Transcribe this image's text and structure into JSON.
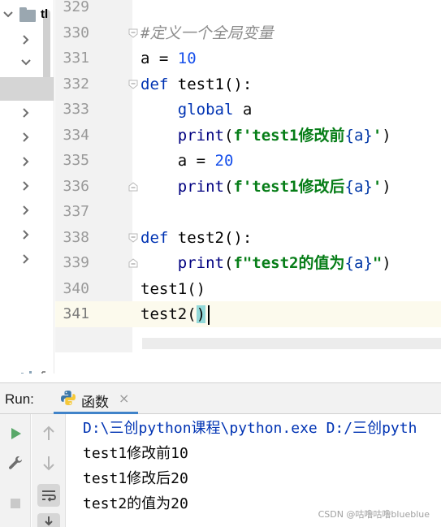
{
  "project_tree": {
    "root_label": "tl",
    "rows": [
      {
        "icon": "chevron-down-icon"
      },
      {
        "icon": "chevron-right-icon"
      },
      {
        "icon": "chevron-down-icon"
      },
      {
        "icon": "none"
      },
      {
        "icon": "chevron-right-icon"
      },
      {
        "icon": "chevron-right-icon"
      },
      {
        "icon": "chevron-right-icon"
      },
      {
        "icon": "chevron-right-icon"
      },
      {
        "icon": "chevron-right-icon"
      },
      {
        "icon": "chevron-right-icon"
      },
      {
        "icon": "chevron-right-icon"
      }
    ]
  },
  "editor": {
    "lines": [
      {
        "num": "329",
        "text": ""
      },
      {
        "num": "330",
        "text": "#定义一个全局变量"
      },
      {
        "num": "331",
        "text": "a = 10"
      },
      {
        "num": "332",
        "text": "def test1():"
      },
      {
        "num": "333",
        "text": "    global a"
      },
      {
        "num": "334",
        "text": "    print(f'test1修改前{a}')"
      },
      {
        "num": "335",
        "text": "    a = 20"
      },
      {
        "num": "336",
        "text": "    print(f'test1修改后{a}')"
      },
      {
        "num": "337",
        "text": ""
      },
      {
        "num": "338",
        "text": "def test2():"
      },
      {
        "num": "339",
        "text": "    print(f\"test2的值为{a}\")"
      },
      {
        "num": "340",
        "text": "test1()"
      },
      {
        "num": "341",
        "text": "test2()"
      }
    ],
    "current_line": "341",
    "colors": {
      "keyword": "#0033b3",
      "number": "#1750eb",
      "string": "#067d17",
      "comment": "#8c8c8c",
      "current_line_bg": "#fcfaed",
      "paren_match": "#93d9d9"
    }
  },
  "run_panel": {
    "title": "Run:",
    "tab_label": "函数",
    "tab_close": "×",
    "left_toolbar": [
      "run-icon",
      "wrench-icon",
      "stop-icon"
    ],
    "right_toolbar": [
      "arrow-up-icon",
      "arrow-down-icon",
      "soft-wrap-icon",
      "scroll-to-end-icon"
    ],
    "console": [
      "D:\\三创python课程\\python.exe D:/三创pyth",
      "test1修改前10",
      "test1修改后20",
      "test2的值为20"
    ]
  },
  "watermark": "CSDN @咕噜咕噜blueblue"
}
